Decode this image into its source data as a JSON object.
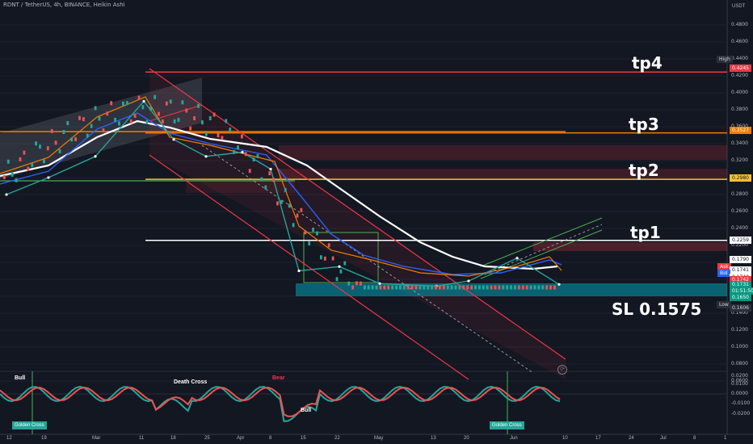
{
  "header": {
    "title": "RDNT / TetherUS, 4h, BINANCE, Heikin Ashi"
  },
  "price_axis": {
    "unit": "USDT",
    "ticks": [
      "0.4800",
      "0.4600",
      "0.4400",
      "0.4200",
      "0.4000",
      "0.3800",
      "0.3600",
      "0.3400",
      "0.3200",
      "0.3000",
      "0.2800",
      "0.2600",
      "0.2400",
      "0.2200",
      "0.2000",
      "0.1800",
      "0.1600",
      "0.1400",
      "0.1200",
      "0.1000",
      "0.0800",
      "0.0600"
    ],
    "tags": [
      {
        "name": "tag-high-label",
        "text": "High",
        "bg": "#2a2e39",
        "color": "#d1d4dc"
      },
      {
        "name": "tag-high-value",
        "text": "0.4290",
        "bg": "#2a2e39",
        "color": "#d1d4dc"
      },
      {
        "name": "tag-tp4",
        "text": "0.4245",
        "bg": "#f23645",
        "color": "#ffffff"
      },
      {
        "name": "tag-tp3",
        "text": "0.3527",
        "bg": "#f57c00",
        "color": "#ffffff"
      },
      {
        "name": "tag-tp2",
        "text": "0.2980",
        "bg": "#fbc02d",
        "color": "#131722"
      },
      {
        "name": "tag-tp1",
        "text": "0.2259",
        "bg": "#ffffff",
        "color": "#131722"
      },
      {
        "name": "tag-ask-value",
        "text": "0.1790",
        "bg": "#ffffff",
        "color": "#131722"
      },
      {
        "name": "tag-ask-label",
        "text": "Ask",
        "bg": "#f23645",
        "color": "#ffffff"
      },
      {
        "name": "tag-ask-price",
        "text": "0.1741",
        "bg": "#ffffff",
        "color": "#131722"
      },
      {
        "name": "tag-bid-label",
        "text": "Bid",
        "bg": "#2962ff",
        "color": "#ffffff"
      },
      {
        "name": "tag-bid-price",
        "text": "0.1740",
        "bg": "#ffffff",
        "color": "#131722"
      },
      {
        "name": "tag-last-a",
        "text": "0.1742",
        "bg": "#f23645",
        "color": "#ffffff"
      },
      {
        "name": "tag-last-b",
        "text": "0.1731",
        "bg": "#089981",
        "color": "#ffffff"
      },
      {
        "name": "tag-countdown",
        "text": "01:51:50",
        "bg": "#089981",
        "color": "#ffffff"
      },
      {
        "name": "tag-zone",
        "text": "0.1650",
        "bg": "#089981",
        "color": "#ffffff"
      },
      {
        "name": "tag-low-label",
        "text": "Low",
        "bg": "#2a2e39",
        "color": "#d1d4dc"
      },
      {
        "name": "tag-low-value",
        "text": "0.1606",
        "bg": "#2a2e39",
        "color": "#d1d4dc"
      }
    ]
  },
  "annotations": {
    "tp4": "tp4",
    "tp3": "tp3",
    "tp2": "tp2",
    "tp1": "tp1",
    "sl": "SL 0.1575"
  },
  "indicator": {
    "axis_ticks": [
      "0.0200",
      "0.0100",
      "0.0000",
      "-0.0100",
      "-0.0200"
    ],
    "labels": [
      {
        "text": "Bull",
        "color": "#ffffff"
      },
      {
        "text": "Death Cross",
        "color": "#ffffff"
      },
      {
        "text": "Bear",
        "color": "#f23645"
      },
      {
        "text": "Bull",
        "color": "#ffffff"
      }
    ],
    "golden_cross_left": "Golden Cross",
    "golden_cross_right": "Golden Cross"
  },
  "time_axis": [
    "12",
    "19",
    "Mar",
    "11",
    "18",
    "25",
    "Apr",
    "8",
    "15",
    "22",
    "May",
    "13",
    "20",
    "Jun",
    "10",
    "17",
    "24",
    "Jul",
    "8",
    "1"
  ],
  "colors": {
    "background": "#131722",
    "tp4": "#f23645",
    "tp3": "#f57c00",
    "tp2": "#fbc02d",
    "tp1": "#ffffff",
    "support": "#089981",
    "bull": "#26a69a",
    "bear": "#ef5350"
  },
  "chart_data": {
    "type": "line",
    "title": "RDNT / TetherUS, 4h, BINANCE, Heikin Ashi",
    "xlabel": "",
    "ylabel": "",
    "ylim": [
      0.06,
      0.48
    ],
    "grid": true,
    "x": [
      "Feb 12",
      "Feb 19",
      "Mar 1",
      "Mar 11",
      "Mar 18",
      "Mar 25",
      "Apr 1",
      "Apr 8",
      "Apr 15",
      "Apr 22",
      "May 1",
      "May 13",
      "May 20",
      "Jun 1",
      "Jun 6"
    ],
    "series": [
      {
        "values": [
          0.28,
          0.3,
          0.325,
          0.39,
          0.345,
          0.325,
          0.33,
          0.31,
          0.19,
          0.195,
          0.175,
          0.172,
          0.178,
          0.205,
          0.174
        ]
      }
    ],
    "levels": [
      {
        "label": "tp4",
        "value": 0.4245
      },
      {
        "label": "tp3",
        "value": 0.3527
      },
      {
        "label": "tp2",
        "value": 0.298
      },
      {
        "label": "tp1",
        "value": 0.2259
      },
      {
        "label": "SL",
        "value": 0.1575
      }
    ]
  }
}
